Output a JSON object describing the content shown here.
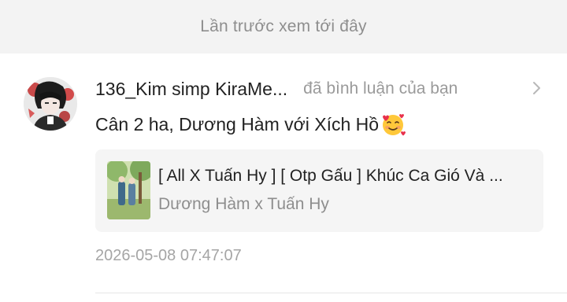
{
  "banner": {
    "text": "Lần trước xem tới đây"
  },
  "notification": {
    "avatar_icon": "user-avatar",
    "username": "136_Kim simp KiraMe...",
    "action": "đã bình luận của bạn",
    "comment": "Cân 2 ha, Dương Hàm với Xích Hồ",
    "emoji_icon": "smiling-face-with-hearts-emoji",
    "story": {
      "title": "[ All X Tuấn Hy ] [ Otp Gấu ] Khúc Ca Gió Và ...",
      "authors": "Dương Hàm x Tuấn Hy",
      "cover_icon": "story-cover-thumbnail"
    },
    "timestamp": "2026-05-08 07:47:07"
  },
  "colors": {
    "banner_bg": "#f3f3f3",
    "card_bg": "#f5f5f5",
    "primary_text": "#222222",
    "secondary_text": "#8e8e8e"
  }
}
